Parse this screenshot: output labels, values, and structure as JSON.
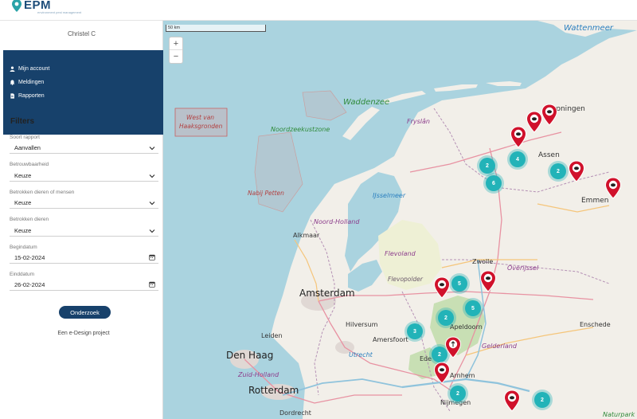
{
  "app": {
    "logo_text": "EPM",
    "logo_subtitle": "environment pest management"
  },
  "sidebar": {
    "user_name": "Christel C",
    "nav": [
      {
        "label": "Mijn account",
        "icon": "user-icon"
      },
      {
        "label": "Meldingen",
        "icon": "bell-icon"
      },
      {
        "label": "Rapporten",
        "icon": "document-icon"
      }
    ],
    "filters_title": "Filters",
    "fields": {
      "report_type": {
        "label": "Soort rapport",
        "value": "Aanvallen"
      },
      "reliability": {
        "label": "Betrouwbaarheid",
        "value": "Keuze"
      },
      "animals_or_people": {
        "label": "Betrokken dieren of mensen",
        "value": "Keuze"
      },
      "animals": {
        "label": "Betrokken dieren",
        "value": "Keuze"
      },
      "start_date": {
        "label": "Begindatum",
        "value": "15-02-2024"
      },
      "end_date": {
        "label": "Einddatum",
        "value": "26-02-2024"
      }
    },
    "search_button": "Onderzoek",
    "footer": "Een e-Design project"
  },
  "map": {
    "scale_label": "50 km",
    "zoom_in": "+",
    "zoom_out": "−",
    "labels": {
      "wattenmeer": "Wattenmeer",
      "waddenzee": "Waddenzee",
      "groningen": "Groningen",
      "fryslan": "Fryslân",
      "noordzeekustzone": "Noordzeekustzone",
      "west_van": "West van",
      "haaksgronden": "Haaksgronden",
      "assen": "Assen",
      "nabij_petten": "Nabij Petten",
      "ijsselmeer": "IJsselmeer",
      "emmen": "Emmen",
      "noord_holland": "Noord-Holland",
      "alkmaar": "Alkmaar",
      "flevoland": "Flevoland",
      "zwolle": "Zwolle",
      "overijssel": "Overijssel",
      "flevopolder": "Flevopolder",
      "amsterdam": "Amsterdam",
      "apeldoorn": "Apeldoorn",
      "leiden": "Leiden",
      "hilversum": "Hilversum",
      "amersfoort": "Amersfoort",
      "enschede": "Enschede",
      "den_haag": "Den Haag",
      "utrecht": "Utrecht",
      "gelderland": "Gelderland",
      "ede": "Ede",
      "zuid_holland": "Zuid-Holland",
      "arnhem": "Arnhem",
      "rotterdam": "Rotterdam",
      "nijmegen": "Nijmegen",
      "dordrecht": "Dordrecht",
      "naturpark": "Naturpark"
    },
    "clusters": [
      {
        "count": "2"
      },
      {
        "count": "4"
      },
      {
        "count": "6"
      },
      {
        "count": "2"
      },
      {
        "count": "5"
      },
      {
        "count": "2"
      },
      {
        "count": "5"
      },
      {
        "count": "3"
      },
      {
        "count": "2"
      },
      {
        "count": "2"
      },
      {
        "count": "2"
      }
    ]
  },
  "colors": {
    "nav_bg": "#17416b",
    "cluster": "#22b3b8",
    "pin": "#d0112b",
    "water": "#aad3df",
    "land": "#f2efe9"
  }
}
